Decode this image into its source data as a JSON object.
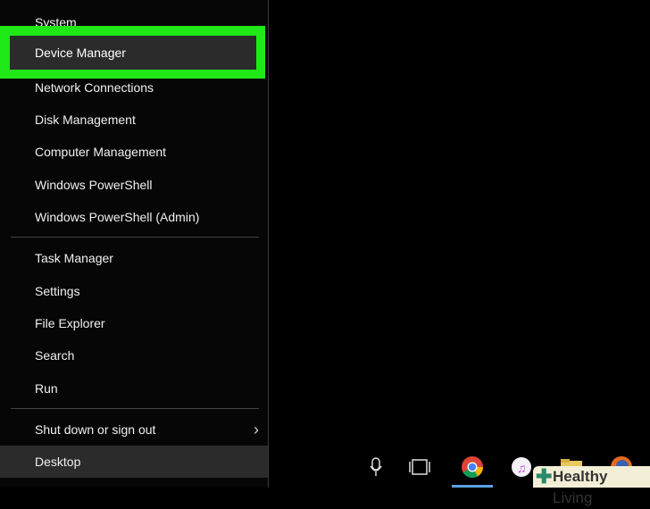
{
  "menu": {
    "items": [
      "System",
      "Device Manager",
      "Network Connections",
      "Disk Management",
      "Computer Management",
      "Windows PowerShell",
      "Windows PowerShell (Admin)",
      "Task Manager",
      "Settings",
      "File Explorer",
      "Search",
      "Run",
      "Shut down or sign out",
      "Desktop"
    ],
    "highlight_color": "#1ee815"
  },
  "taskbar": {
    "icons": [
      "microphone-icon",
      "task-view-icon",
      "chrome-icon",
      "itunes-icon",
      "folder-icon",
      "firefox-icon"
    ]
  },
  "watermark": {
    "brand": "Healthy",
    "brand2": "Living"
  }
}
